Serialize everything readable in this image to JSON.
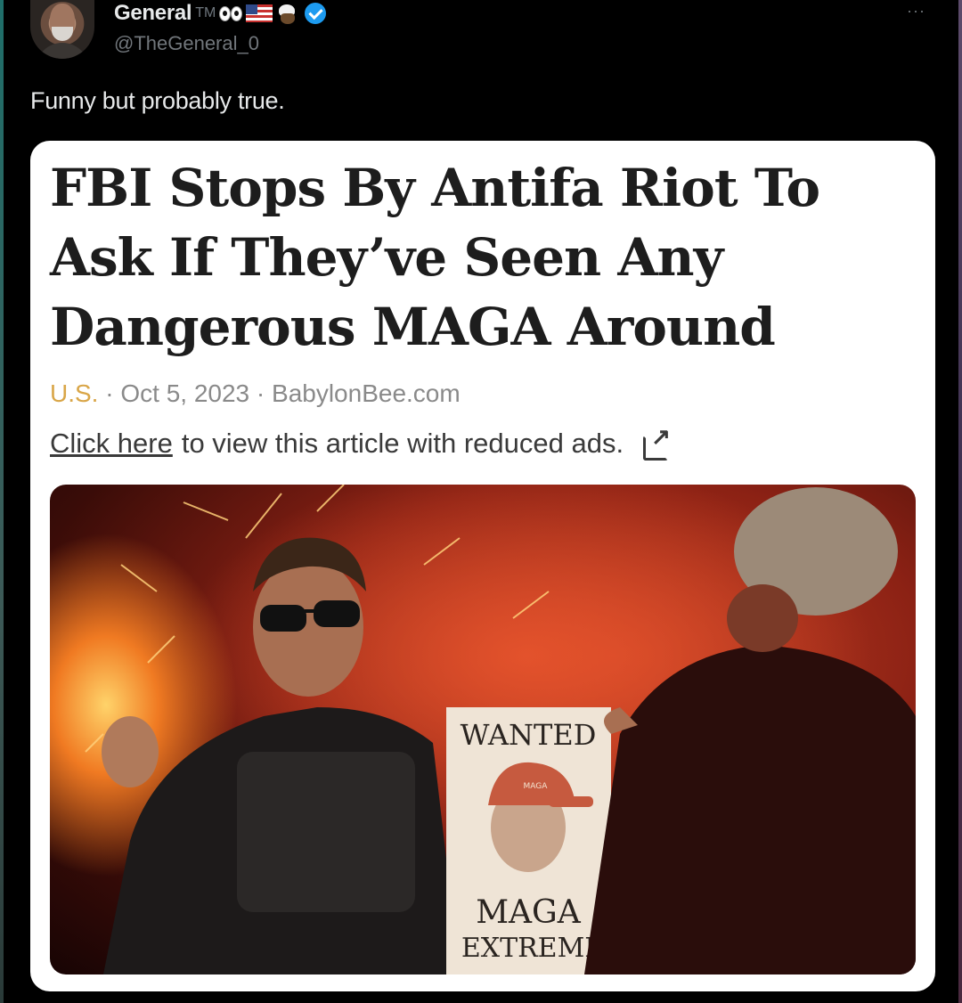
{
  "post": {
    "author": {
      "display_name": "General",
      "tm": "TM",
      "handle": "@TheGeneral_0",
      "badges": [
        "eyes-icon",
        "us-flag-icon",
        "eagle-icon",
        "verified-icon"
      ]
    },
    "more_label": "···",
    "text": "Funny but probably true."
  },
  "card": {
    "headline": "FBI Stops By Antifa Riot To Ask If They’ve Seen Any Dangerous MAGA Around",
    "category": "U.S.",
    "separator": "·",
    "date": "Oct 5, 2023",
    "source": "BabylonBee.com",
    "link_text": "Click here",
    "link_suffix": "to view this article with reduced ads.",
    "image": {
      "poster_top": "WANTED",
      "poster_bottom_1": "MAGA",
      "poster_bottom_2": "EXTREMI",
      "cap_text": "MAGA"
    }
  },
  "colors": {
    "background": "#000000",
    "text": "#e7e9ea",
    "muted": "#71767b",
    "verified": "#1d9bf0",
    "category": "#d9a648"
  }
}
